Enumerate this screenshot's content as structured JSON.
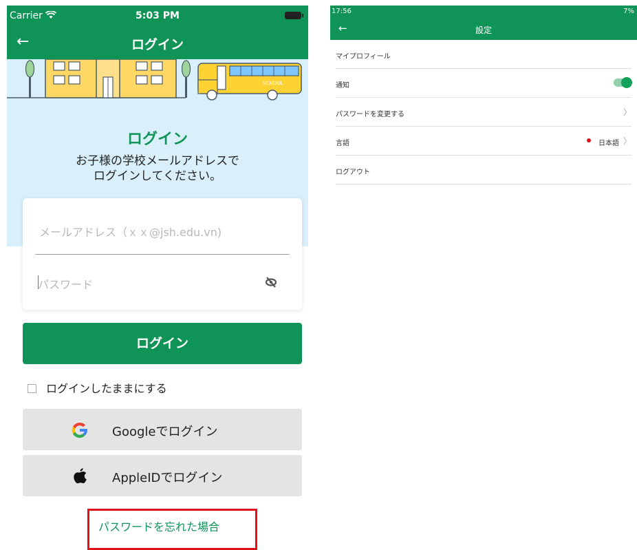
{
  "left": {
    "status": {
      "carrier": "Carrier",
      "time": "5:03 PM"
    },
    "nav": {
      "title": "ログイン"
    },
    "login_title": "ログイン",
    "login_desc_line1": "お子様の学校メールアドレスで",
    "login_desc_line2": "ログインしてください。",
    "email_placeholder": "メールアドレス（ｘｘ@jsh.edu.vn)",
    "password_placeholder": "パスワード",
    "login_button": "ログイン",
    "remember_label": "ログインしたままにする",
    "google_button": "Googleでログイン",
    "apple_button": "AppleIDでログイン",
    "forgot_password": "パスワードを忘れた場合",
    "bus_text": "SCHOOL"
  },
  "right": {
    "status": {
      "time": "17:56",
      "right": "7%"
    },
    "appbar": {
      "title": "設定"
    },
    "items": [
      {
        "label": "マイプロフィール"
      },
      {
        "label": "通知"
      },
      {
        "label": "パスワードを変更する"
      },
      {
        "label": "言語"
      },
      {
        "label": "ログアウト"
      }
    ],
    "language_value": "日本語",
    "notification_enabled": true
  },
  "colors": {
    "primary": "#0f9357",
    "hero_bg": "#d9f0fb",
    "highlight": "#e0111a"
  },
  "icons": [
    "back-arrow-icon",
    "wifi-icon",
    "battery-icon",
    "eye-off-icon",
    "google-icon",
    "apple-icon",
    "chevron-right-icon",
    "japan-flag-icon",
    "toggle-switch"
  ]
}
